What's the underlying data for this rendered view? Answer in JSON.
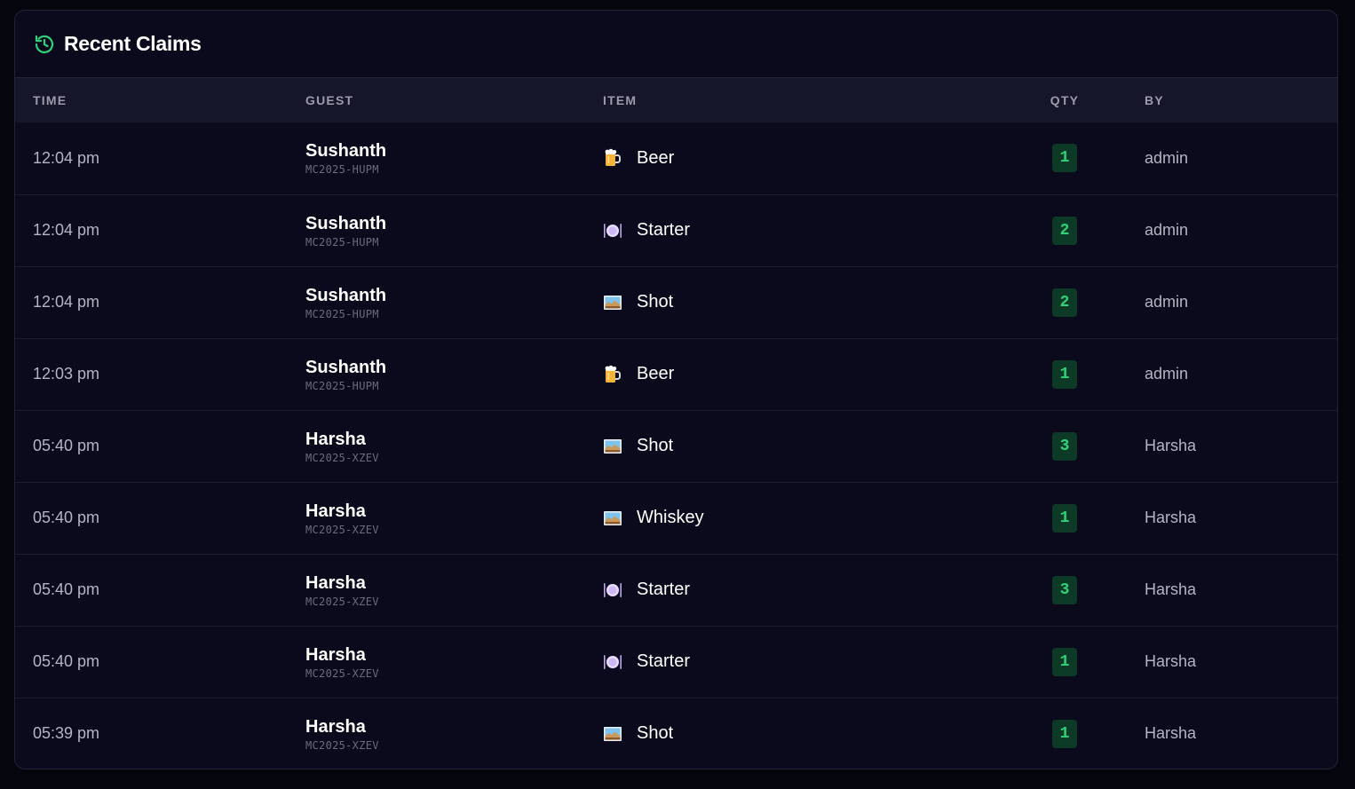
{
  "header": {
    "title": "Recent Claims",
    "icon": "history-icon",
    "accent_color": "#2fd27a"
  },
  "table": {
    "columns": {
      "time": "TIME",
      "guest": "GUEST",
      "item": "ITEM",
      "qty": "QTY",
      "by": "BY"
    },
    "rows": [
      {
        "time": "12:04 pm",
        "guest_name": "Sushanth",
        "guest_code": "MC2025-HUPM",
        "item": "Beer",
        "item_icon": "beer-icon",
        "qty": "1",
        "by": "admin"
      },
      {
        "time": "12:04 pm",
        "guest_name": "Sushanth",
        "guest_code": "MC2025-HUPM",
        "item": "Starter",
        "item_icon": "plate-icon",
        "qty": "2",
        "by": "admin"
      },
      {
        "time": "12:04 pm",
        "guest_name": "Sushanth",
        "guest_code": "MC2025-HUPM",
        "item": "Shot",
        "item_icon": "picture-icon",
        "qty": "2",
        "by": "admin"
      },
      {
        "time": "12:03 pm",
        "guest_name": "Sushanth",
        "guest_code": "MC2025-HUPM",
        "item": "Beer",
        "item_icon": "beer-icon",
        "qty": "1",
        "by": "admin"
      },
      {
        "time": "05:40 pm",
        "guest_name": "Harsha",
        "guest_code": "MC2025-XZEV",
        "item": "Shot",
        "item_icon": "picture-icon",
        "qty": "3",
        "by": "Harsha"
      },
      {
        "time": "05:40 pm",
        "guest_name": "Harsha",
        "guest_code": "MC2025-XZEV",
        "item": "Whiskey",
        "item_icon": "picture-icon",
        "qty": "1",
        "by": "Harsha"
      },
      {
        "time": "05:40 pm",
        "guest_name": "Harsha",
        "guest_code": "MC2025-XZEV",
        "item": "Starter",
        "item_icon": "plate-icon",
        "qty": "3",
        "by": "Harsha"
      },
      {
        "time": "05:40 pm",
        "guest_name": "Harsha",
        "guest_code": "MC2025-XZEV",
        "item": "Starter",
        "item_icon": "plate-icon",
        "qty": "1",
        "by": "Harsha"
      },
      {
        "time": "05:39 pm",
        "guest_name": "Harsha",
        "guest_code": "MC2025-XZEV",
        "item": "Shot",
        "item_icon": "picture-icon",
        "qty": "1",
        "by": "Harsha"
      }
    ]
  }
}
